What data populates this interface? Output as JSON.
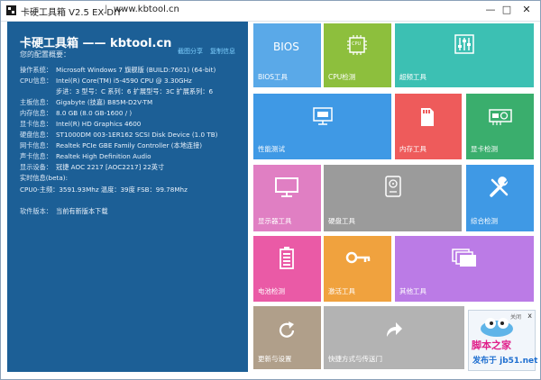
{
  "window": {
    "title": "卡硬工具箱 V2.5  EX-DIY",
    "separator": "|",
    "url": "www.kbtool.cn",
    "min": "—",
    "max": "□",
    "close": "✕"
  },
  "left": {
    "brand": "卡硬工具箱 —— kbtool.cn",
    "subheading": "您的配置概要：",
    "link_share": "截图分享",
    "link_copy": "复制信息",
    "rows": [
      {
        "k": "操作系统：",
        "v": "Microsoft Windows 7 旗舰版 (BUILD:7601) (64-bit)"
      },
      {
        "k": "CPU信息：",
        "v": "Intel(R) Core(TM) i5-4590 CPU @ 3.30GHz"
      },
      {
        "k": "",
        "v": "步进：3 型号：C 系列：6 扩展型号：3C 扩展系列：6"
      },
      {
        "k": "主板信息：",
        "v": "Gigabyte (技嘉) B85M-D2V-TM"
      },
      {
        "k": "内存信息：",
        "v": "8.0 GB (8.0 GB-1600 / )"
      },
      {
        "k": "显卡信息：",
        "v": "Intel(R) HD Graphics 4600"
      },
      {
        "k": "硬盘信息：",
        "v": "ST1000DM 003-1ER162 SCSI Disk Device (1.0 TB)"
      },
      {
        "k": "网卡信息：",
        "v": "Realtek PCIe GBE Family Controller (本地连接)"
      },
      {
        "k": "声卡信息：",
        "v": "Realtek High Definition Audio"
      },
      {
        "k": "显示设备：",
        "v": "冠捷 AOC 2217 [AOC2217] 22英寸"
      },
      {
        "k": "",
        "v": "实时信息(beta):"
      },
      {
        "k": "",
        "v": "CPU0-主频：3591.93Mhz 温度：39度 FSB：99.78Mhz"
      },
      {
        "k": "",
        "v": ""
      },
      {
        "k": "软件版本：",
        "v": "当前有新版本下载"
      }
    ]
  },
  "tiles": {
    "bios": {
      "label": "BIOS工具",
      "icon_text": "BIOS",
      "color": "#5aa9e8"
    },
    "cpu": {
      "label": "CPU检测",
      "icon_text": "CPU",
      "color": "#8dbf3d"
    },
    "oc": {
      "label": "超频工具",
      "color": "#3cc0b3"
    },
    "perf": {
      "label": "性能测试",
      "color": "#3f99e5"
    },
    "mem": {
      "label": "内存工具",
      "color": "#ee5b5b"
    },
    "gpu": {
      "label": "显卡检测",
      "color": "#3aae6d"
    },
    "monitor": {
      "label": "显示器工具",
      "color": "#e07fc3"
    },
    "disk": {
      "label": "硬盘工具",
      "color": "#9b9b9b"
    },
    "hw": {
      "label": "综合检测",
      "color": "#3f99e5"
    },
    "battery": {
      "label": "电池检测",
      "color": "#ea5aa6"
    },
    "activate": {
      "label": "激活工具",
      "color": "#f0a23e"
    },
    "other": {
      "label": "其他工具",
      "color": "#bb7be6"
    },
    "update": {
      "label": "更新与设置",
      "color": "#b09f8a"
    },
    "shortcut": {
      "label": "快捷方式与传送门",
      "color": "#b3b3b3"
    }
  },
  "ad": {
    "close": "x",
    "hint": "关闭",
    "text1": "脚本之家",
    "text2": "发布于 jb51.net"
  }
}
